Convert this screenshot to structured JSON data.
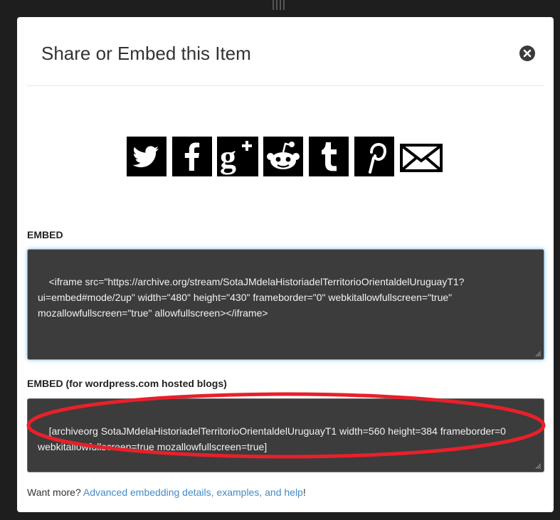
{
  "modal": {
    "title": "Share or Embed this Item"
  },
  "share": {
    "items": [
      {
        "icon": "twitter-icon"
      },
      {
        "icon": "facebook-icon"
      },
      {
        "icon": "google-plus-icon"
      },
      {
        "icon": "reddit-icon"
      },
      {
        "icon": "tumblr-icon"
      },
      {
        "icon": "pinterest-icon"
      },
      {
        "icon": "email-icon"
      }
    ]
  },
  "embed": {
    "label": "EMBED",
    "code": "<iframe src=\"https://archive.org/stream/SotaJMdelaHistoriadelTerritorioOrientaldelUruguayT1?ui=embed#mode/2up\" width=\"480\" height=\"430\" frameborder=\"0\" webkitallowfullscreen=\"true\" mozallowfullscreen=\"true\" allowfullscreen></iframe>"
  },
  "wordpress": {
    "label": "EMBED (for wordpress.com hosted blogs)",
    "code": "[archiveorg SotaJMdelaHistoriadelTerritorioOrientaldelUruguayT1 width=560 height=384 frameborder=0 webkitallowfullscreen=true mozallowfullscreen=true]"
  },
  "footer": {
    "prefix": "Want more? ",
    "link_text": "Advanced embedding details, examples, and help",
    "suffix": "!"
  },
  "colors": {
    "modal_bg": "#ffffff",
    "textarea_bg": "#3c3c3c",
    "link": "#428bca",
    "annotation": "#e8202a",
    "focus_glow": "#66afe9"
  }
}
